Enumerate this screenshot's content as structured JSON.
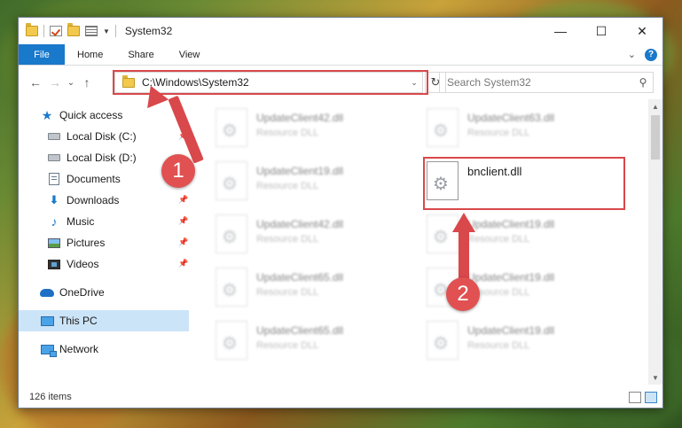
{
  "window": {
    "title": "System32"
  },
  "window_controls": {
    "minimize": "—",
    "maximize": "☐",
    "close": "✕"
  },
  "ribbon": {
    "tabs": [
      "File",
      "Home",
      "Share",
      "View"
    ],
    "expand": "⌄",
    "help": "?"
  },
  "address_bar": {
    "path": "C:\\Windows\\System32",
    "search_placeholder": "Search System32"
  },
  "nav_glyphs": {
    "back": "←",
    "forward": "→",
    "recent": "⌄",
    "up": "↑",
    "refresh": "↻",
    "search": "⚲"
  },
  "nav_pane": {
    "items": [
      {
        "label": "Quick access",
        "icon": "star-icon"
      },
      {
        "label": "Local Disk (C:)",
        "icon": "drive-icon",
        "pinned": true
      },
      {
        "label": "Local Disk (D:)",
        "icon": "drive-icon"
      },
      {
        "label": "Documents",
        "icon": "documents-icon",
        "pinned": true
      },
      {
        "label": "Downloads",
        "icon": "download-icon",
        "pinned": true
      },
      {
        "label": "Music",
        "icon": "music-icon",
        "pinned": true
      },
      {
        "label": "Pictures",
        "icon": "pictures-icon",
        "pinned": true
      },
      {
        "label": "Videos",
        "icon": "videos-icon",
        "pinned": true
      },
      {
        "label": "OneDrive",
        "icon": "onedrive-icon"
      },
      {
        "label": "This PC",
        "icon": "pc-icon",
        "selected": true
      },
      {
        "label": "Network",
        "icon": "network-icon"
      }
    ]
  },
  "files": {
    "left_column": [
      {
        "name": "UpdateClient42.dll",
        "type": "Resource DLL"
      },
      {
        "name": "UpdateClient19.dll",
        "type": "Resource DLL"
      },
      {
        "name": "UpdateClient42.dll",
        "type": "Resource DLL"
      },
      {
        "name": "UpdateClient65.dll",
        "type": "Resource DLL"
      },
      {
        "name": "UpdateClient65.dll",
        "type": "Resource DLL"
      }
    ],
    "right_column": [
      {
        "name": "UpdateClient63.dll",
        "type": "Resource DLL"
      },
      {
        "name": "bnclient.dll",
        "type": "",
        "highlighted": true
      },
      {
        "name": "UpdateClient19.dll",
        "type": "Resource DLL"
      },
      {
        "name": "UpdateClient19.dll",
        "type": "Resource DLL"
      },
      {
        "name": "UpdateClient19.dll",
        "type": "Resource DLL"
      }
    ]
  },
  "status": {
    "items": "126 items"
  },
  "callouts": {
    "step1": "1",
    "step2": "2"
  },
  "colors": {
    "accent": "#1979ca",
    "highlight": "#d9484b"
  }
}
